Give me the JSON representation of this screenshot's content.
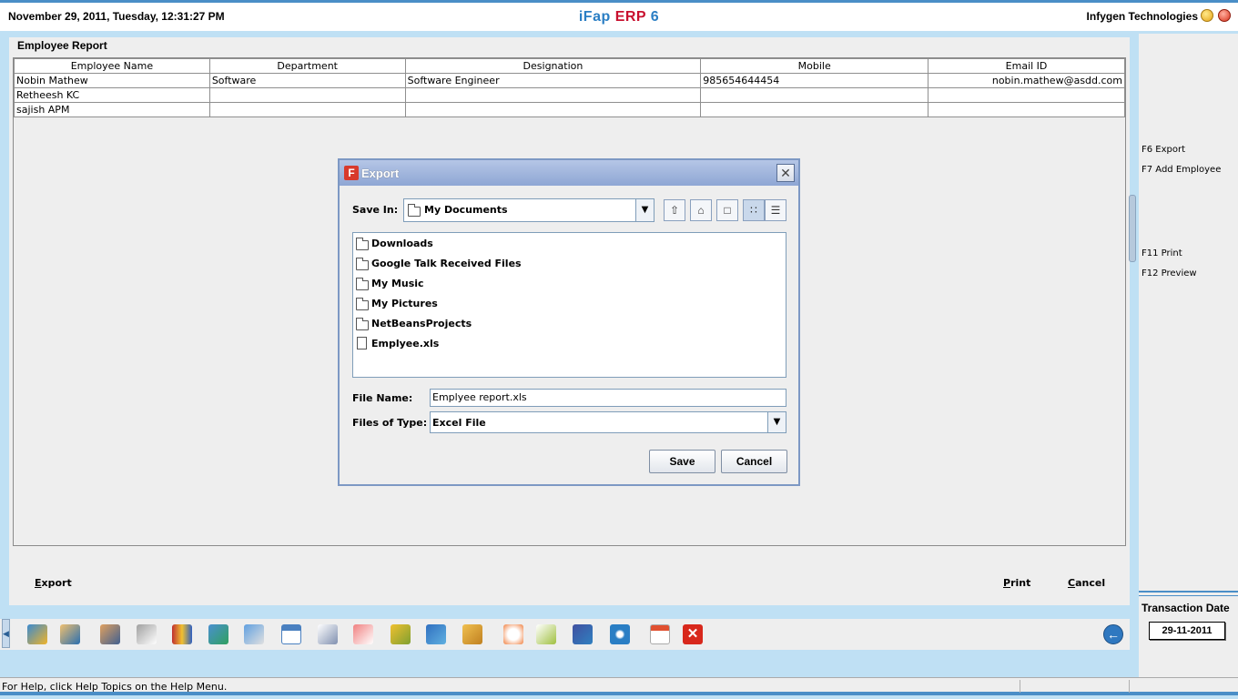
{
  "titlebar": {
    "datetime": "November  29, 2011, Tuesday, 12:31:27 PM",
    "app_name_a": "iFap",
    "app_name_b": "ERP",
    "app_name_c": "6",
    "company": "Infygen Technologies"
  },
  "report": {
    "title": "Employee Report",
    "columns": [
      "Employee Name",
      "Department",
      "Designation",
      "Mobile",
      "Email ID"
    ],
    "rows": [
      [
        "Nobin Mathew",
        "Software",
        "Software Engineer",
        "985654644454",
        "nobin.mathew@asdd.com"
      ],
      [
        "Retheesh KC",
        "",
        "",
        "",
        ""
      ],
      [
        "sajish APM",
        "",
        "",
        "",
        ""
      ]
    ]
  },
  "bottom_buttons": {
    "export": "Export",
    "print": "Print",
    "cancel": "Cancel"
  },
  "sidebar": {
    "items": [
      "F6 Export",
      "F7 Add Employee",
      "F11 Print",
      "F12 Preview"
    ],
    "transaction_label": "Transaction Date",
    "transaction_date": "29-11-2011"
  },
  "statusbar": {
    "help_text": "For Help, click Help Topics on the Help Menu."
  },
  "dialog": {
    "title": "Export",
    "save_in_label": "Save In:",
    "save_in_value": "My Documents",
    "files": [
      {
        "name": "Downloads",
        "type": "folder"
      },
      {
        "name": "Google Talk Received Files",
        "type": "folder"
      },
      {
        "name": "My Music",
        "type": "folder"
      },
      {
        "name": "My Pictures",
        "type": "folder"
      },
      {
        "name": "NetBeansProjects",
        "type": "folder"
      },
      {
        "name": "Emplyee.xls",
        "type": "file"
      }
    ],
    "file_name_label": "File Name:",
    "file_name_value": "Emplyee report.xls",
    "files_of_type_label": "Files of Type:",
    "files_of_type_value": "Excel File",
    "save_button": "Save",
    "cancel_button": "Cancel"
  },
  "colors": {
    "accent": "#4a8ec7",
    "brand_blue": "#2a7ec4",
    "brand_red": "#c8102e"
  }
}
